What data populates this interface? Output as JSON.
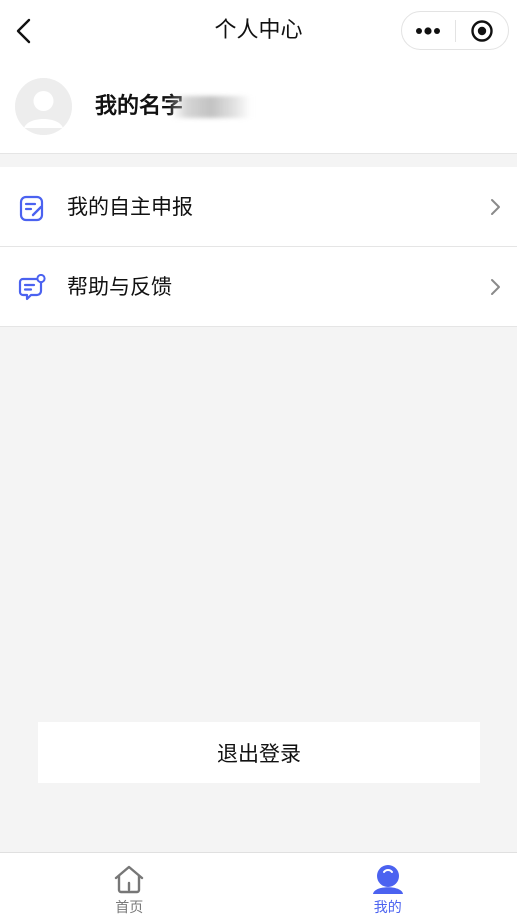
{
  "navbar": {
    "title": "个人中心",
    "back_icon": "chevron-left-icon",
    "more_icon": "more-dots-icon",
    "target_icon": "target-circle-icon"
  },
  "profile": {
    "name": "我的名字",
    "avatar_icon": "default-avatar-icon"
  },
  "menu": {
    "items": [
      {
        "label": "我的自主申报",
        "icon": "edit-document-icon"
      },
      {
        "label": "帮助与反馈",
        "icon": "feedback-chat-icon"
      }
    ]
  },
  "logout": {
    "label": "退出登录"
  },
  "tabbar": {
    "tabs": [
      {
        "label": "首页",
        "icon": "home-icon",
        "active": false
      },
      {
        "label": "我的",
        "icon": "user-icon",
        "active": true
      }
    ]
  },
  "colors": {
    "accent": "#4b62f0",
    "background": "#f4f4f4",
    "inactive_tab": "#7a7a7a"
  }
}
